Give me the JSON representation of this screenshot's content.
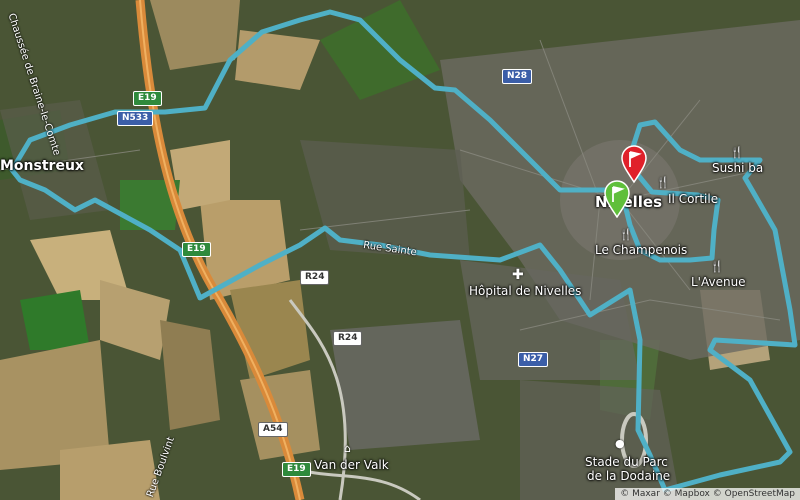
{
  "map": {
    "places": {
      "monstreux": "Monstreux",
      "nivelles": "Nivelles",
      "hospital": "Hôpital de Nivelles",
      "champenois": "Le Champenois",
      "il_cortile": "Il Cortile",
      "sushi": "Sushi ba",
      "lavenue": "L'Avenue",
      "stade_line1": "Stade du Parc",
      "stade_line2": "de la Dodaine",
      "vandervalk": "Van der Valk"
    },
    "roads": {
      "chaussee": "Chaussée de Braine-le-Comte",
      "rue_buisson": "Rue Sainte",
      "rue_boulvint": "Rue Boulvint"
    },
    "shields": {
      "e19_top": "E19",
      "e19_mid": "E19",
      "e19_bottom": "E19",
      "n28": "N28",
      "n27": "N27",
      "n533": "N533",
      "r24_a": "R24",
      "r24_b": "R24",
      "a54": "A54"
    },
    "route_color": "#4fb0c6",
    "start_marker_color": "#5fbf3b",
    "end_marker_color": "#e0202a",
    "icons": {
      "start": "green-flag-marker-icon",
      "end": "red-flag-marker-icon",
      "hospital": "hospital-cross-icon",
      "restaurant": "fork-knife-icon",
      "hotel": "hotel-bed-icon"
    }
  },
  "attribution": "© Maxar © Mapbox © OpenStreetMap"
}
